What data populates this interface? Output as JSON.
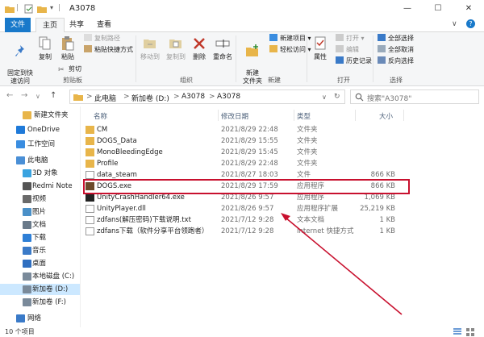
{
  "window": {
    "title": "A3078",
    "minimize": "—",
    "maximize": "☐",
    "close": "✕"
  },
  "tabs": {
    "file": "文件",
    "home": "主页",
    "share": "共享",
    "view": "查看"
  },
  "ribbon": {
    "clipboard": {
      "label": "剪贴板",
      "pin": "固定到快\n速访问",
      "copy": "复制",
      "paste": "粘贴",
      "copy_path": "复制路径",
      "paste_shortcut": "粘贴快捷方式",
      "cut": "剪切"
    },
    "organize": {
      "label": "组织",
      "move_to": "移动到",
      "copy_to": "复制到",
      "delete": "删除",
      "rename": "重命名"
    },
    "new": {
      "label": "新建",
      "new_folder": "新建\n文件夹",
      "new_item": "新建项目 ▾",
      "easy_access": "轻松访问 ▾"
    },
    "open": {
      "label": "打开",
      "properties": "属性",
      "open": "打开 ▾",
      "edit": "编辑",
      "history": "历史记录"
    },
    "select": {
      "label": "选择",
      "select_all": "全部选择",
      "select_none": "全部取消",
      "invert": "反向选择"
    }
  },
  "address": {
    "back": "←",
    "forward": "→",
    "up_list": "∨",
    "up": "↑",
    "crumb_sep": ">",
    "crumb_root": "此电脑",
    "crumb_drive": "新加卷 (D:)",
    "crumb_folder1": "A3078",
    "crumb_folder2": "A3078",
    "dropdown": "∨",
    "refresh": "↻",
    "search_placeholder": "搜索\"A3078\""
  },
  "nav": {
    "items": [
      {
        "label": "新建文件夹",
        "color": "#e8b54a"
      },
      {
        "label": "OneDrive",
        "color": "#1f7ad9"
      },
      {
        "label": "工作空间",
        "color": "#3a8de0"
      },
      {
        "label": "此电脑",
        "color": "#4a8fd6"
      },
      {
        "label": "3D 对象",
        "color": "#3aa3e0"
      },
      {
        "label": "Redmi Note",
        "color": "#555555"
      },
      {
        "label": "视频",
        "color": "#6a6a6a"
      },
      {
        "label": "图片",
        "color": "#4a90c8"
      },
      {
        "label": "文档",
        "color": "#6a7a8a"
      },
      {
        "label": "下载",
        "color": "#2e7fd6"
      },
      {
        "label": "音乐",
        "color": "#3a7ac8"
      },
      {
        "label": "桌面",
        "color": "#2f6fc0"
      },
      {
        "label": "本地磁盘 (C:)",
        "color": "#7a8a9a"
      },
      {
        "label": "新加卷 (D:)",
        "color": "#7a8a9a"
      },
      {
        "label": "新加卷 (F:)",
        "color": "#7a8a9a"
      },
      {
        "label": "网络",
        "color": "#3a7ac8"
      }
    ]
  },
  "columns": {
    "name": "名称",
    "date": "修改日期",
    "type": "类型",
    "size": "大小"
  },
  "files": [
    {
      "name": "CM",
      "date": "2021/8/29 22:48",
      "type": "文件夹",
      "size": "",
      "kind": "folder"
    },
    {
      "name": "DOGS_Data",
      "date": "2021/8/29 15:55",
      "type": "文件夹",
      "size": "",
      "kind": "folder"
    },
    {
      "name": "MonoBleedingEdge",
      "date": "2021/8/29 15:45",
      "type": "文件夹",
      "size": "",
      "kind": "folder"
    },
    {
      "name": "Profile",
      "date": "2021/8/29 22:48",
      "type": "文件夹",
      "size": "",
      "kind": "folder"
    },
    {
      "name": "data_steam",
      "date": "2021/8/27 18:03",
      "type": "文件",
      "size": "866 KB",
      "kind": "file"
    },
    {
      "name": "DOGS.exe",
      "date": "2021/8/29 17:59",
      "type": "应用程序",
      "size": "866 KB",
      "kind": "exe"
    },
    {
      "name": "UnityCrashHandler64.exe",
      "date": "2021/8/26 9:57",
      "type": "应用程序",
      "size": "1,069 KB",
      "kind": "exe2"
    },
    {
      "name": "UnityPlayer.dll",
      "date": "2021/8/26 9:57",
      "type": "应用程序扩展",
      "size": "25,219 KB",
      "kind": "dll"
    },
    {
      "name": "zdfans(解压密码)下载说明.txt",
      "date": "2021/7/12 9:28",
      "type": "文本文档",
      "size": "1 KB",
      "kind": "txt"
    },
    {
      "name": "zdfans下载（软件分享平台领跑者）",
      "date": "2021/7/12 9:28",
      "type": "Internet 快捷方式",
      "size": "1 KB",
      "kind": "url"
    }
  ],
  "status": {
    "count": "10 个项目"
  },
  "colors": {
    "accent": "#1979ca",
    "highlight": "#c8102e",
    "selection": "#cce8ff"
  }
}
